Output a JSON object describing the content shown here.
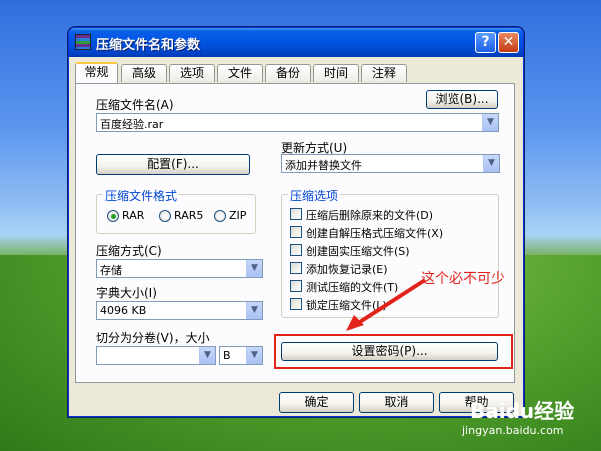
{
  "window": {
    "title": "压缩文件名和参数",
    "help_label": "?",
    "close_label": "✕"
  },
  "tabs": [
    "常规",
    "高级",
    "选项",
    "文件",
    "备份",
    "时间",
    "注释"
  ],
  "general": {
    "archive_name_label": "压缩文件名(A)",
    "browse_button": "浏览(B)...",
    "archive_name_value": "百度经验.rar",
    "update_mode_label": "更新方式(U)",
    "update_mode_value": "添加并替换文件",
    "profiles_button": "配置(F)...",
    "format_group_title": "压缩文件格式",
    "formats": [
      "RAR",
      "RAR5",
      "ZIP"
    ],
    "selected_format": "RAR",
    "method_label": "压缩方式(C)",
    "method_value": "存储",
    "dictionary_label": "字典大小(I)",
    "dictionary_value": "4096 KB",
    "split_label": "切分为分卷(V)，大小",
    "split_value": "",
    "split_unit": "B",
    "options_group_title": "压缩选项",
    "options": [
      {
        "label": "压缩后删除原来的文件(D)",
        "checked": false
      },
      {
        "label": "创建自解压格式压缩文件(X)",
        "checked": false
      },
      {
        "label": "创建固实压缩文件(S)",
        "checked": false
      },
      {
        "label": "添加恢复记录(E)",
        "checked": false
      },
      {
        "label": "测试压缩的文件(T)",
        "checked": false
      },
      {
        "label": "锁定压缩文件(L)",
        "checked": false
      }
    ],
    "password_button": "设置密码(P)..."
  },
  "footer": {
    "ok_button": "确定",
    "cancel_button": "取消",
    "help_button": "帮助"
  },
  "annotation": {
    "text": "这个必不可少",
    "color": "#e2231a"
  },
  "watermark": {
    "brand": "Baidu经验",
    "url": "jingyan.baidu.com"
  }
}
